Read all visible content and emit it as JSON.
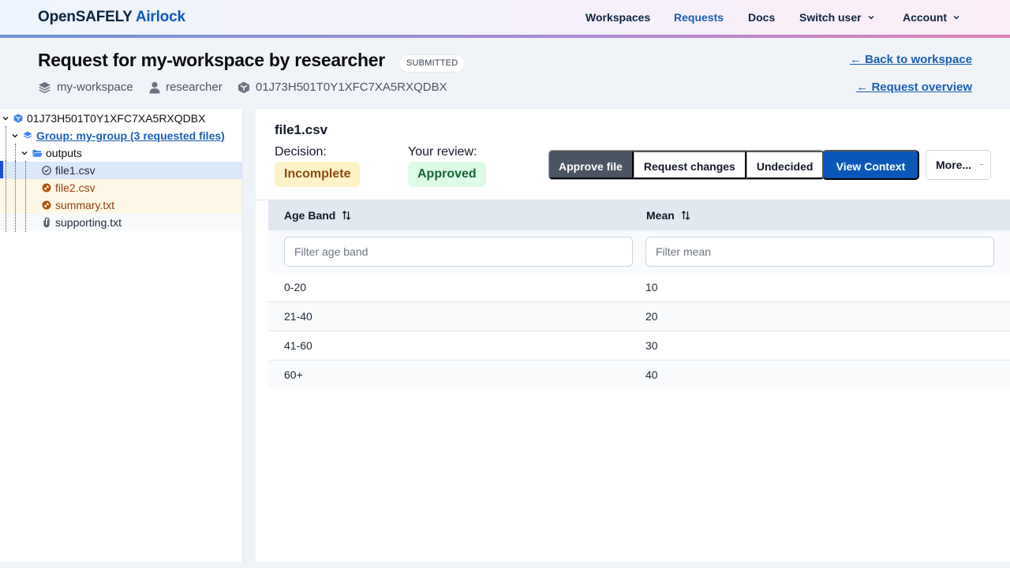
{
  "header": {
    "brand_main": "OpenSAFELY",
    "brand_accent": "Airlock",
    "nav": [
      {
        "label": "Workspaces",
        "active": false
      },
      {
        "label": "Requests",
        "active": true
      },
      {
        "label": "Docs",
        "active": false
      },
      {
        "label": "Switch user",
        "dropdown": true
      },
      {
        "label": "Account",
        "dropdown": true
      }
    ]
  },
  "page": {
    "title": "Request for my-workspace by researcher",
    "status": "SUBMITTED",
    "meta": {
      "workspace": "my-workspace",
      "user": "researcher",
      "request_id": "01J73H501T0Y1XFC7XA5RXQDBX"
    },
    "links": {
      "back_to_workspace": "← Back to workspace",
      "request_overview": "← Request overview"
    }
  },
  "tree": {
    "root": "01J73H501T0Y1XFC7XA5RXQDBX",
    "group": "Group: my-group (3 requested files)",
    "folder": "outputs",
    "files": [
      {
        "name": "file1.csv",
        "state": "reviewed",
        "icon": "check-circle-icon",
        "selected": true
      },
      {
        "name": "file2.csv",
        "state": "pending",
        "icon": "half-circle-icon"
      },
      {
        "name": "summary.txt",
        "state": "pending",
        "icon": "half-circle-icon"
      },
      {
        "name": "supporting.txt",
        "state": "supporting",
        "icon": "paperclip-icon"
      }
    ]
  },
  "file": {
    "name": "file1.csv",
    "decision_label": "Decision:",
    "decision_value": "Incomplete",
    "review_label": "Your review:",
    "review_value": "Approved",
    "actions": {
      "approve": "Approve file",
      "request_changes": "Request changes",
      "undecided": "Undecided",
      "view_context": "View Context",
      "more": "More..."
    }
  },
  "table": {
    "columns": [
      "Age Band",
      "Mean"
    ],
    "filters": {
      "age_band": "Filter age band",
      "mean": "Filter mean"
    },
    "rows": [
      [
        "0-20",
        "10"
      ],
      [
        "21-40",
        "20"
      ],
      [
        "41-60",
        "30"
      ],
      [
        "60+",
        "40"
      ]
    ]
  },
  "colors": {
    "accent": "#0b57b8",
    "selected_row": "#dbe8fb",
    "pending_row": "#fdf8e6",
    "warning_badge": "#fef3c7",
    "success_badge": "#dcfce7"
  }
}
